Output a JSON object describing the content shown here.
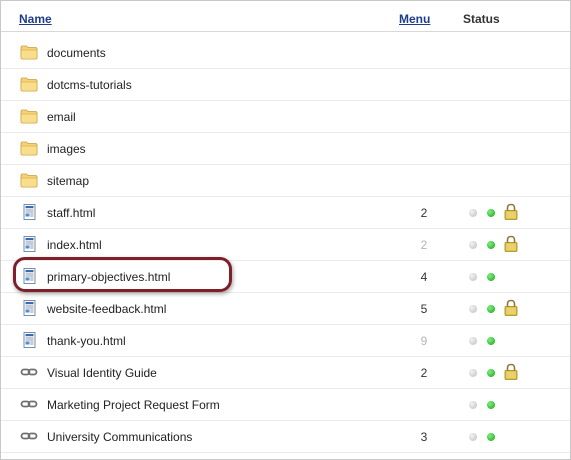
{
  "header": {
    "name_label": "Name",
    "menu_label": "Menu",
    "status_label": "Status"
  },
  "rows": [
    {
      "type": "folder",
      "icon": "folder-icon",
      "label": "documents",
      "menu": "",
      "menu_dim": false,
      "status": []
    },
    {
      "type": "folder",
      "icon": "folder-icon",
      "label": "dotcms-tutorials",
      "menu": "",
      "menu_dim": false,
      "status": []
    },
    {
      "type": "folder",
      "icon": "folder-icon",
      "label": "email",
      "menu": "",
      "menu_dim": false,
      "status": []
    },
    {
      "type": "folder",
      "icon": "folder-icon",
      "label": "images",
      "menu": "",
      "menu_dim": false,
      "status": []
    },
    {
      "type": "folder",
      "icon": "folder-icon",
      "label": "sitemap",
      "menu": "",
      "menu_dim": false,
      "status": []
    },
    {
      "type": "page",
      "icon": "html-page-icon",
      "label": "staff.html",
      "menu": "2",
      "menu_dim": false,
      "status": [
        "grey",
        "green",
        "lock"
      ]
    },
    {
      "type": "page",
      "icon": "html-page-icon",
      "label": "index.html",
      "menu": "2",
      "menu_dim": true,
      "status": [
        "grey",
        "green",
        "lock"
      ]
    },
    {
      "type": "page",
      "icon": "html-page-icon",
      "label": "primary-objectives.html",
      "menu": "4",
      "menu_dim": false,
      "status": [
        "grey",
        "green"
      ]
    },
    {
      "type": "page",
      "icon": "html-page-icon",
      "label": "website-feedback.html",
      "menu": "5",
      "menu_dim": false,
      "status": [
        "grey",
        "green",
        "lock"
      ]
    },
    {
      "type": "page",
      "icon": "html-page-icon",
      "label": "thank-you.html",
      "menu": "9",
      "menu_dim": true,
      "status": [
        "grey",
        "green"
      ]
    },
    {
      "type": "link",
      "icon": "link-icon",
      "label": "Visual Identity Guide",
      "menu": "2",
      "menu_dim": false,
      "status": [
        "grey",
        "green",
        "lock"
      ]
    },
    {
      "type": "link",
      "icon": "link-icon",
      "label": "Marketing Project Request Form",
      "menu": "",
      "menu_dim": false,
      "status": [
        "grey",
        "green"
      ]
    },
    {
      "type": "link",
      "icon": "link-icon",
      "label": "University Communications",
      "menu": "3",
      "menu_dim": false,
      "status": [
        "grey",
        "green"
      ]
    }
  ],
  "highlighted_row": "primary-objectives.html",
  "colors": {
    "header_link": "#1f3c8c",
    "highlight_border": "#7e1f2a",
    "status_green": "#1aa51a",
    "status_grey": "#bdbdbd"
  }
}
